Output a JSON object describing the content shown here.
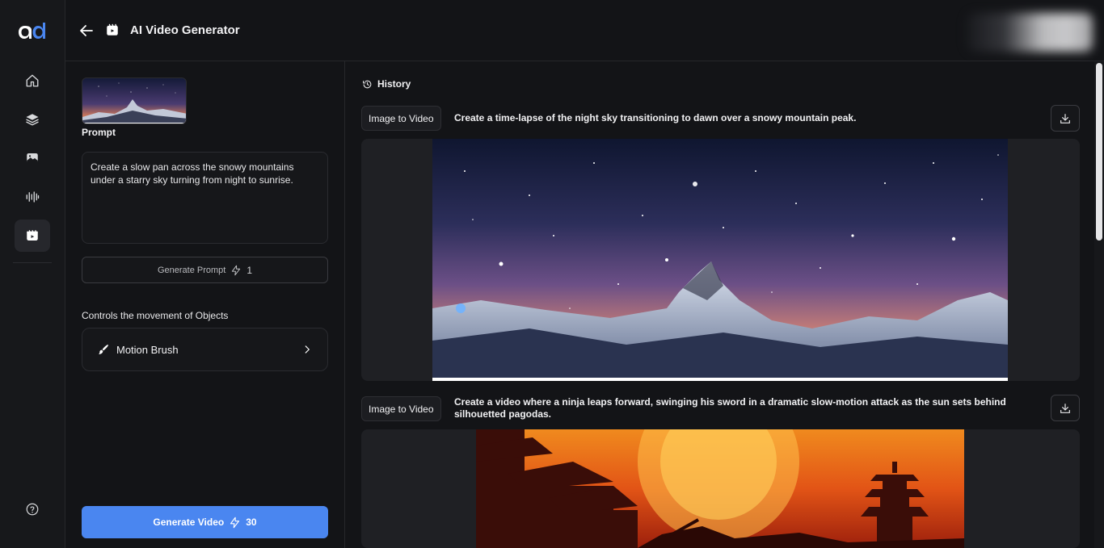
{
  "header": {
    "title": "AI Video Generator"
  },
  "sidebar": {
    "items": [
      {
        "name": "home-icon",
        "active": false
      },
      {
        "name": "layers-icon",
        "active": false
      },
      {
        "name": "image-icon",
        "active": false
      },
      {
        "name": "audio-waveform-icon",
        "active": false
      },
      {
        "name": "video-icon",
        "active": true
      }
    ],
    "help": {
      "name": "help-icon"
    }
  },
  "left_panel": {
    "prompt_label": "Prompt",
    "prompt_text": "Create a slow pan across the snowy mountains under a starry sky turning from night to sunrise.",
    "generate_prompt": {
      "label": "Generate Prompt",
      "cost": "1"
    },
    "controls_label": "Controls the movement of Objects",
    "motion_brush_label": "Motion Brush",
    "generate_video": {
      "label": "Generate Video",
      "cost": "30"
    }
  },
  "history": {
    "title": "History",
    "entries": [
      {
        "tag": "Image to Video",
        "prompt": "Create a time-lapse of the night sky transitioning to dawn over a snowy mountain peak."
      },
      {
        "tag": "Image to Video",
        "prompt": "Create a video where a ninja leaps forward, swinging his sword in a dramatic slow-motion attack as the sun sets behind silhouetted pagodas."
      }
    ]
  },
  "colors": {
    "accent": "#4a86f0",
    "background": "#131417",
    "sidebar": "#17181b"
  }
}
